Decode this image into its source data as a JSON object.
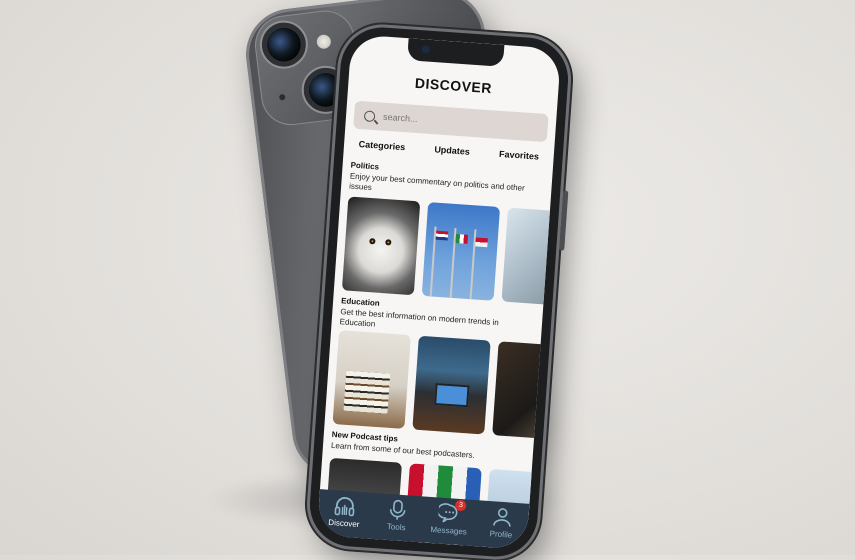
{
  "app": {
    "title": "DISCOVER"
  },
  "search": {
    "placeholder": "search..."
  },
  "tabs": [
    {
      "label": "Categories"
    },
    {
      "label": "Updates"
    },
    {
      "label": "Favorites"
    }
  ],
  "sections": [
    {
      "title": "Politics",
      "description": "Enjoy your best commentary on politics and other issues",
      "images": [
        "snowy-owl",
        "flags-on-poles",
        "building-interior"
      ]
    },
    {
      "title": "Education",
      "description": "Get the best information on modern trends in Education",
      "images": [
        "stack-of-books-with-glasses",
        "laptop-on-desk",
        "dark-room"
      ]
    },
    {
      "title": "New  Podcast tips",
      "description": "Learn from some of our best podcasters.",
      "images": [
        "podcast-room",
        "flags",
        "window-scene"
      ]
    }
  ],
  "nav": [
    {
      "label": "Discover",
      "icon": "headphones-icon",
      "active": true
    },
    {
      "label": "Tools",
      "icon": "microphone-icon"
    },
    {
      "label": "Messages",
      "icon": "chat-bubble-icon",
      "badge": "3"
    },
    {
      "label": "Profile",
      "icon": "user-icon"
    }
  ],
  "colors": {
    "navbar": "#2b3a4a",
    "nav_icon": "#8fb7cc",
    "badge": "#d6302c",
    "search_bg": "#ddd6d3"
  }
}
